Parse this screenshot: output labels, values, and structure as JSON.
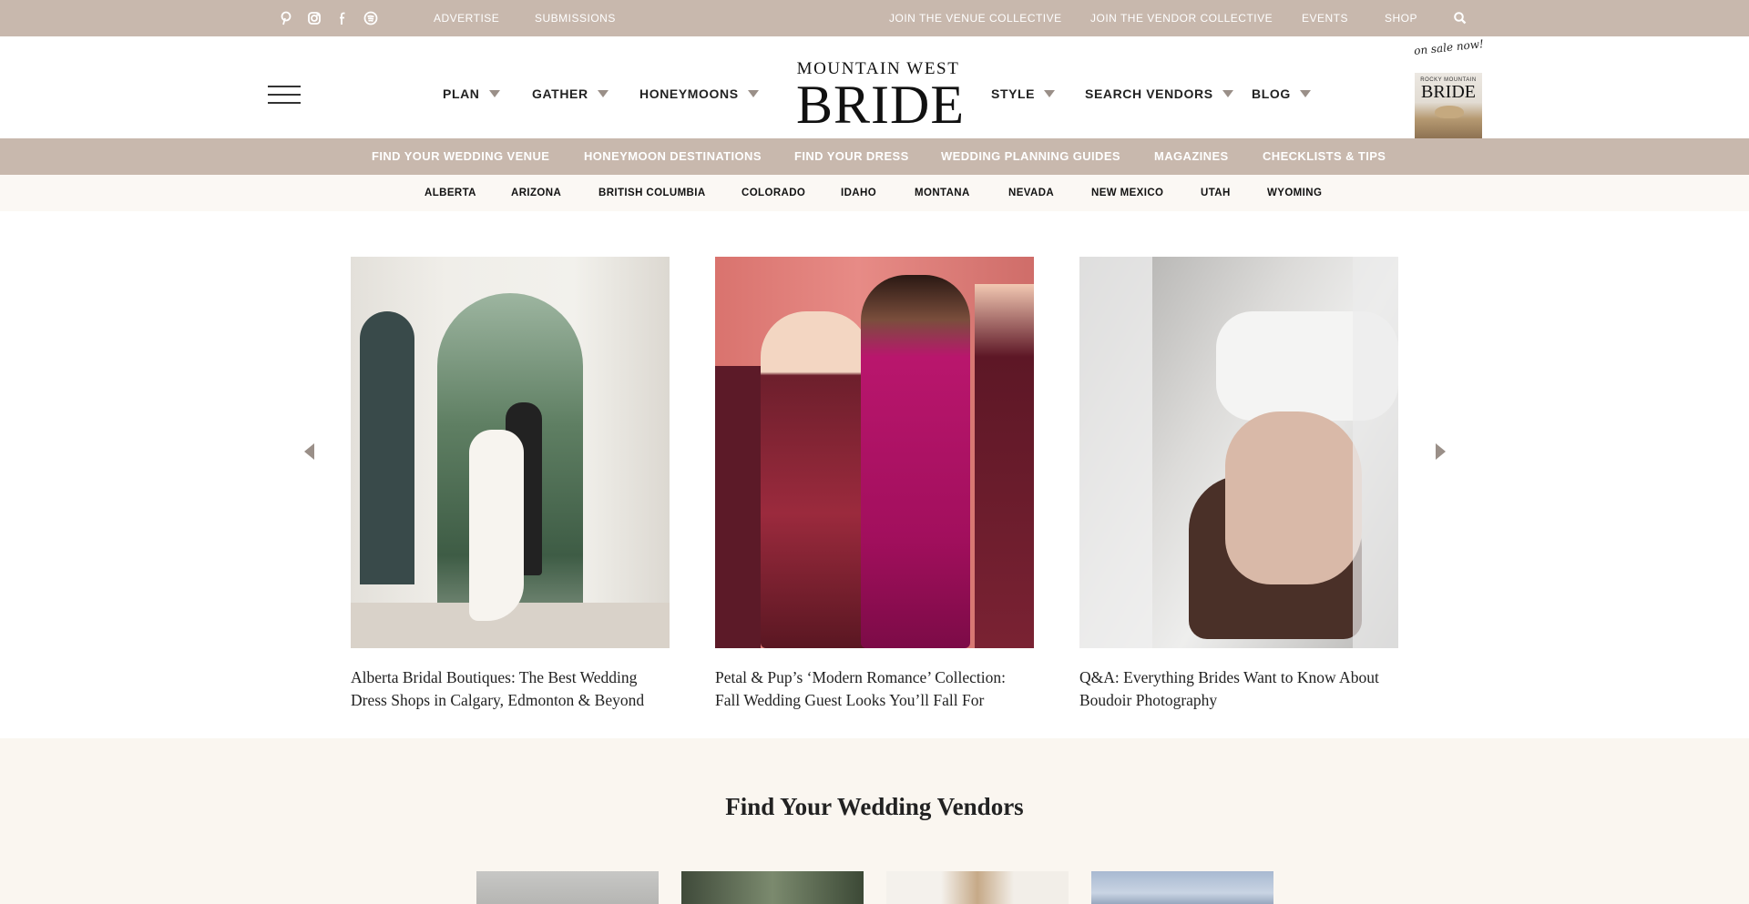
{
  "topbar": {
    "social_icons": [
      "pinterest-icon",
      "instagram-icon",
      "facebook-icon",
      "spotify-icon"
    ],
    "left_links": [
      "ADVERTISE",
      "SUBMISSIONS"
    ],
    "right_links": [
      "JOIN THE VENUE COLLECTIVE",
      "JOIN THE VENDOR COLLECTIVE",
      "EVENTS",
      "SHOP"
    ],
    "search_icon": "search-icon",
    "bg_color": "#c8b8ad"
  },
  "header": {
    "logo_top": "MOUNTAIN WEST",
    "logo_main": "BRIDE",
    "nav": [
      "PLAN",
      "GATHER",
      "HONEYMOONS",
      "STYLE",
      "SEARCH VENDORS",
      "BLOG"
    ],
    "promo": {
      "tagline": "on sale now!",
      "cover_small": "ROCKY MOUNTAIN",
      "cover_big": "BRIDE"
    }
  },
  "category_bar": {
    "items": [
      "FIND YOUR WEDDING VENUE",
      "HONEYMOON DESTINATIONS",
      "FIND YOUR DRESS",
      "WEDDING PLANNING GUIDES",
      "MAGAZINES",
      "CHECKLISTS & TIPS"
    ]
  },
  "state_bar": {
    "items": [
      "ALBERTA",
      "ARIZONA",
      "BRITISH COLUMBIA",
      "COLORADO",
      "IDAHO",
      "MONTANA",
      "NEVADA",
      "NEW MEXICO",
      "UTAH",
      "WYOMING"
    ]
  },
  "carousel": {
    "cards": [
      {
        "caption": "Alberta Bridal Boutiques: The Best Wedding Dress Shops in Calgary, Edmonton & Beyond"
      },
      {
        "caption": "Petal & Pup’s ‘Modern Romance’ Collection: Fall Wedding Guest Looks You’ll Fall For"
      },
      {
        "caption": "Q&A: Everything Brides Want to Know About Boudoir Photography"
      }
    ]
  },
  "vendors": {
    "title": "Find Your Wedding Vendors"
  }
}
